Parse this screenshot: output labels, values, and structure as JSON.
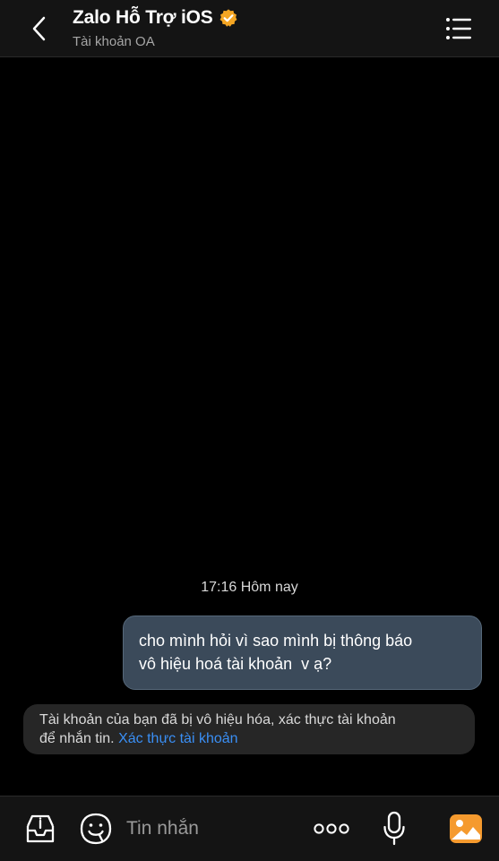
{
  "header": {
    "title": "Zalo Hỗ Trợ iOS",
    "subtitle": "Tài khoản OA",
    "verified_icon": "verified-check-badge",
    "back_icon": "chevron-left-icon",
    "menu_icon": "list-menu-icon"
  },
  "chat": {
    "timestamp": "17:16 Hôm nay",
    "messages": [
      {
        "direction": "outgoing",
        "lines": [
          "cho mình hỏi vì sao mình bị thông báo",
          "vô hiệu hoá tài khoản  v ạ?"
        ]
      }
    ],
    "notice": {
      "text_line1": "Tài khoản của bạn đã bị vô hiệu hóa, xác thực tài khoản",
      "text_line2": "để nhắn tin. ",
      "link": "Xác thực tài khoản"
    }
  },
  "toolbar": {
    "placeholder": "Tin nhắn",
    "icons": [
      "inbox-info-icon",
      "sticker-icon",
      "more-dots-icon",
      "microphone-icon",
      "image-gallery-icon"
    ]
  },
  "colors": {
    "background": "#000000",
    "header_bg": "#141414",
    "bubble_out": "#3b4a5a",
    "notice_bg": "#262626",
    "link": "#3a8ff5",
    "verified": "#f5a623",
    "gallery": "#f59a2e"
  }
}
